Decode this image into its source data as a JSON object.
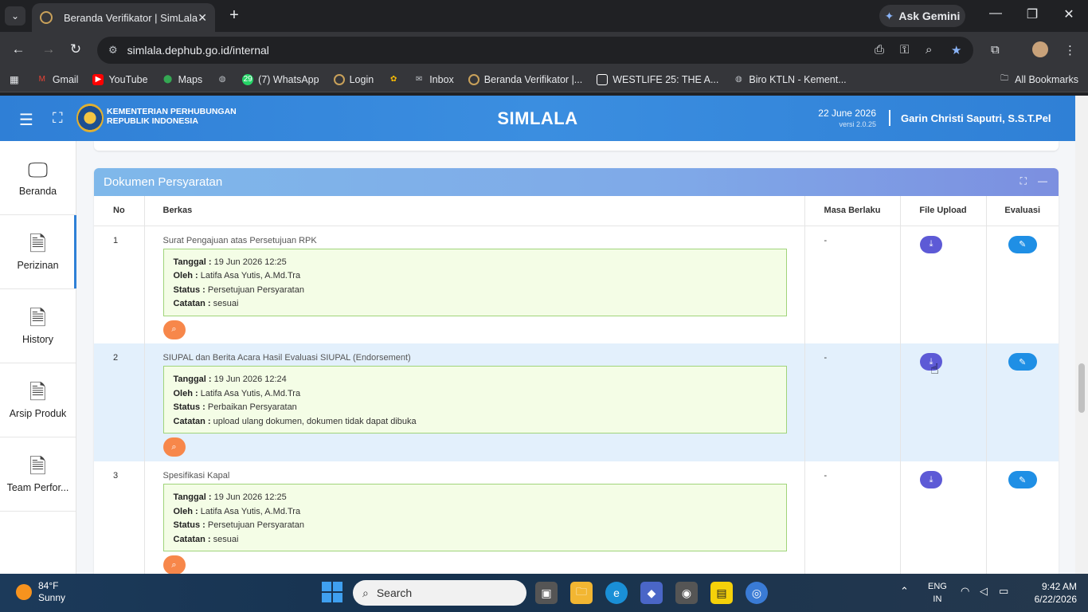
{
  "browser": {
    "tab_title": "Beranda Verifikator | SimLala",
    "url": "simlala.dephub.go.id/internal",
    "ask_gemini": "Ask Gemini",
    "bookmarks": [
      {
        "label": "Gmail",
        "icon": "gmail-icon",
        "color": "#ea4335"
      },
      {
        "label": "YouTube",
        "icon": "youtube-icon",
        "color": "#ff0000"
      },
      {
        "label": "Maps",
        "icon": "maps-icon",
        "color": "#34a853"
      },
      {
        "label": "",
        "icon": "globe-icon",
        "color": "#bdc1c6"
      },
      {
        "label": "(7) WhatsApp",
        "icon": "whatsapp-icon",
        "color": "#25d366",
        "badge": "29"
      },
      {
        "label": "Login",
        "icon": "login-icon",
        "color": "#c9a15a"
      },
      {
        "label": "",
        "icon": "photos-icon",
        "color": "#fbbc04"
      },
      {
        "label": "Inbox",
        "icon": "mail-icon",
        "color": "#bdc1c6"
      },
      {
        "label": "Beranda Verifikator |...",
        "icon": "simlala-icon",
        "color": "#c9a15a"
      },
      {
        "label": "WESTLIFE 25: THE A...",
        "icon": "page-icon",
        "color": "#ffffff"
      },
      {
        "label": "Biro KTLN - Kement...",
        "icon": "globe-icon",
        "color": "#bdc1c6"
      }
    ],
    "all_bookmarks": "All Bookmarks"
  },
  "header": {
    "org_line1": "KEMENTERIAN PERHUBUNGAN",
    "org_line2": "REPUBLIK INDONESIA",
    "app_title": "SIMLALA",
    "date": "22 June 2026",
    "version": "versi 2.0.25",
    "user_name": "Garin Christi Saputri, S.S.T.Pel"
  },
  "sidebar": {
    "items": [
      {
        "label": "Beranda",
        "icon": "monitor-icon"
      },
      {
        "label": "Perizinan",
        "icon": "document-icon"
      },
      {
        "label": "History",
        "icon": "document-icon"
      },
      {
        "label": "Arsip Produk",
        "icon": "document-icon"
      },
      {
        "label": "Team Perfor...",
        "icon": "document-icon"
      }
    ]
  },
  "card": {
    "title": "Dokumen Persyaratan",
    "columns": [
      "No",
      "Berkas",
      "Masa Berlaku",
      "File Upload",
      "Evaluasi"
    ],
    "rows": [
      {
        "no": "1",
        "title": "Surat Pengajuan atas Persetujuan RPK",
        "tanggal": "19 Jun 2026 12:25",
        "oleh": "Latifa Asa Yutis, A.Md.Tra",
        "status": "Persetujuan Persyaratan",
        "catatan": "sesuai",
        "masa": "-"
      },
      {
        "no": "2",
        "title": "SIUPAL dan Berita Acara Hasil Evaluasi SIUPAL (Endorsement)",
        "tanggal": "19 Jun 2026 12:24",
        "oleh": "Latifa Asa Yutis, A.Md.Tra",
        "status": "Perbaikan Persyaratan",
        "catatan": "upload ulang dokumen, dokumen tidak dapat dibuka",
        "masa": "-"
      },
      {
        "no": "3",
        "title": "Spesifikasi Kapal",
        "tanggal": "19 Jun 2026 12:25",
        "oleh": "Latifa Asa Yutis, A.Md.Tra",
        "status": "Persetujuan Persyaratan",
        "catatan": "sesuai",
        "masa": "-"
      }
    ],
    "labels": {
      "tanggal": "Tanggal :",
      "oleh": "Oleh :",
      "status": "Status :",
      "catatan": "Catatan :"
    }
  },
  "taskbar": {
    "temp": "84°F",
    "condition": "Sunny",
    "search": "Search",
    "lang1": "ENG",
    "lang2": "IN",
    "time": "9:42 AM",
    "date": "6/22/2026"
  }
}
